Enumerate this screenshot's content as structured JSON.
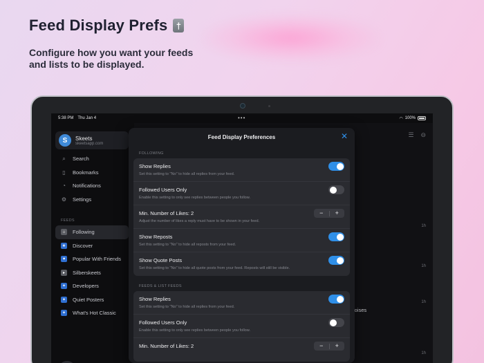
{
  "hero": {
    "title": "Feed Display Prefs",
    "subtitle": "Configure how you want your feeds and lists to be displayed.",
    "emoji": "†"
  },
  "status_bar": {
    "time": "5:38 PM",
    "date": "Thu Jan 4",
    "battery": "100%"
  },
  "account": {
    "name": "Skeets",
    "handle": "skeetsapp.com",
    "initial": "S"
  },
  "nav": [
    {
      "label": "Search",
      "icon": "search-icon"
    },
    {
      "label": "Bookmarks",
      "icon": "bookmark-icon"
    },
    {
      "label": "Notifications",
      "icon": "bell-icon"
    },
    {
      "label": "Settings",
      "icon": "gear-icon"
    }
  ],
  "feeds_label": "FEEDS",
  "feeds": [
    {
      "label": "Following",
      "active": true
    },
    {
      "label": "Discover"
    },
    {
      "label": "Popular With Friends"
    },
    {
      "label": "Silberskeets"
    },
    {
      "label": "Developers"
    },
    {
      "label": "Quiet Posters"
    },
    {
      "label": "What's Hot Classic"
    }
  ],
  "timeline": {
    "times": [
      "1h",
      "1h",
      "1h",
      "1h"
    ],
    "snippet": "weird audio noises"
  },
  "modal": {
    "title": "Feed Display Preferences",
    "sections": [
      {
        "label": "FOLLOWING",
        "rows": [
          {
            "title": "Show Replies",
            "desc": "Set this setting to \"No\" to hide all replies from your feed.",
            "control": "toggle",
            "on": true
          },
          {
            "title": "Followed Users Only",
            "desc": "Enable this setting to only see replies between people you follow.",
            "control": "toggle",
            "on": false
          },
          {
            "title": "Min. Number of Likes: 2",
            "desc": "Adjust the number of likes a reply must have to be shown in your feed.",
            "control": "stepper"
          },
          {
            "title": "Show Reposts",
            "desc": "Set this setting to \"No\" to hide all reposts from your feed.",
            "control": "toggle",
            "on": true
          },
          {
            "title": "Show Quote Posts",
            "desc": "Set this setting to \"No\" to hide all quote posts from your feed. Reposts will still be visible.",
            "control": "toggle",
            "on": true
          }
        ]
      },
      {
        "label": "FEEDS & LIST FEEDS",
        "rows": [
          {
            "title": "Show Replies",
            "desc": "Set this setting to \"No\" to hide all replies from your feed.",
            "control": "toggle",
            "on": true
          },
          {
            "title": "Followed Users Only",
            "desc": "Enable this setting to only see replies between people you follow.",
            "control": "toggle",
            "on": false
          },
          {
            "title": "Min. Number of Likes: 2",
            "desc": "",
            "control": "stepper"
          }
        ]
      }
    ],
    "stepper_minus": "−",
    "stepper_plus": "+",
    "close_glyph": "✕"
  }
}
